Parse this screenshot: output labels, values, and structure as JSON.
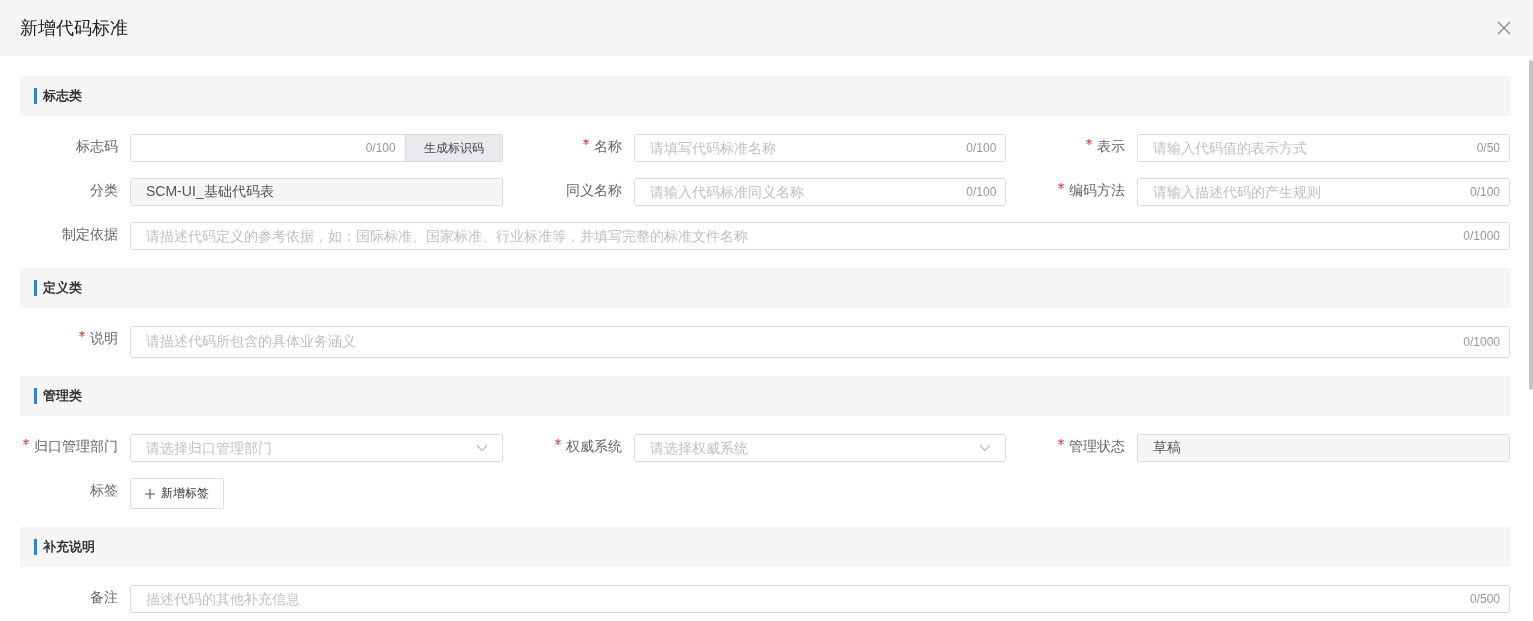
{
  "dialog": {
    "title": "新增代码标准"
  },
  "sections": [
    {
      "title": "标志类",
      "fields": [
        {
          "kind": "input_button",
          "label": "标志码",
          "required": false,
          "counter": "0/100",
          "button": "生成标识码"
        },
        {
          "kind": "text",
          "label": "名称",
          "required": true,
          "placeholder": "请填写代码标准名称",
          "counter": "0/100"
        },
        {
          "kind": "text",
          "label": "表示",
          "required": true,
          "placeholder": "请输入代码值的表示方式",
          "counter": "0/50"
        },
        {
          "kind": "readonly",
          "label": "分类",
          "required": false,
          "value": "SCM-UI_基础代码表"
        },
        {
          "kind": "text",
          "label": "同义名称",
          "required": false,
          "placeholder": "请输入代码标准同义名称",
          "counter": "0/100"
        },
        {
          "kind": "text",
          "label": "编码方法",
          "required": true,
          "placeholder": "请输入描述代码的产生规则",
          "counter": "0/100"
        },
        {
          "kind": "long_text",
          "label": "制定依据",
          "required": false,
          "placeholder": "请描述代码定义的参考依据，如：国际标准、国家标准、行业标准等，并填写完整的标准文件名称",
          "counter": "0/1000"
        }
      ]
    },
    {
      "title": "定义类",
      "fields": [
        {
          "kind": "textarea",
          "label": "说明",
          "required": true,
          "placeholder": "请描述代码所包含的具体业务涵义",
          "counter": "0/1000"
        }
      ]
    },
    {
      "title": "管理类",
      "fields": [
        {
          "kind": "select",
          "label": "归口管理部门",
          "required": true,
          "placeholder": "请选择归口管理部门"
        },
        {
          "kind": "select",
          "label": "权威系统",
          "required": true,
          "placeholder": "请选择权威系统"
        },
        {
          "kind": "readonly",
          "label": "管理状态",
          "required": true,
          "value": "草稿"
        },
        {
          "kind": "tag",
          "label": "标签",
          "required": false,
          "button": "新增标签"
        }
      ]
    },
    {
      "title": "补充说明",
      "fields": [
        {
          "kind": "long_text",
          "label": "备注",
          "required": false,
          "placeholder": "描述代码的其他补充信息",
          "counter": "0/500"
        }
      ]
    }
  ]
}
